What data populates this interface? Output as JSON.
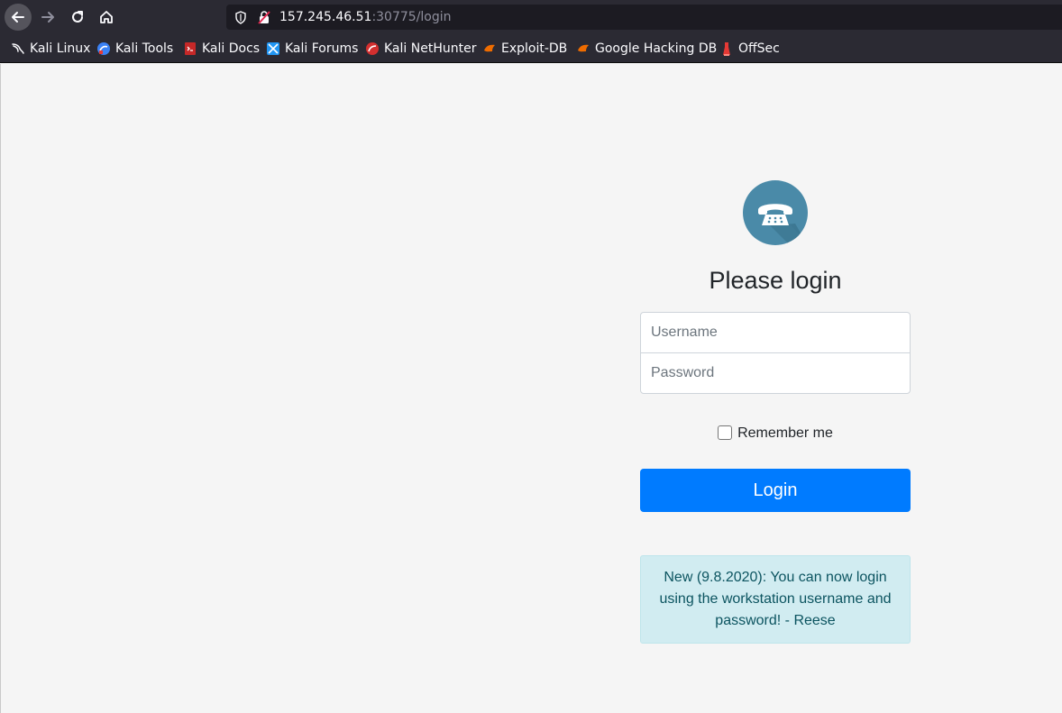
{
  "browser": {
    "url_host": "157.245.46.51",
    "url_rest": ":30775/login",
    "bookmarks": [
      {
        "label": "Kali Linux",
        "icon": "kali-dragon-icon"
      },
      {
        "label": "Kali Tools",
        "icon": "kali-tools-icon"
      },
      {
        "label": "Kali Docs",
        "icon": "kali-docs-icon"
      },
      {
        "label": "Kali Forums",
        "icon": "kali-forums-icon"
      },
      {
        "label": "Kali NetHunter",
        "icon": "kali-nethunter-icon"
      },
      {
        "label": "Exploit-DB",
        "icon": "exploit-db-icon"
      },
      {
        "label": "Google Hacking DB",
        "icon": "ghdb-icon"
      },
      {
        "label": "OffSec",
        "icon": "offsec-icon"
      }
    ]
  },
  "login": {
    "logo_icon": "telephone-icon",
    "logo_glyph": "☎",
    "heading": "Please login",
    "username_placeholder": "Username",
    "password_placeholder": "Password",
    "remember_label": "Remember me",
    "button_label": "Login",
    "notice": "New (9.8.2020): You can now login using the workstation username and password! - Reese"
  },
  "colors": {
    "primary": "#007bff",
    "logo_bg": "#4a8aa8",
    "alert_bg": "#d1ecf1",
    "alert_text": "#0c5460",
    "toolbar_bg": "#2b2a33"
  }
}
